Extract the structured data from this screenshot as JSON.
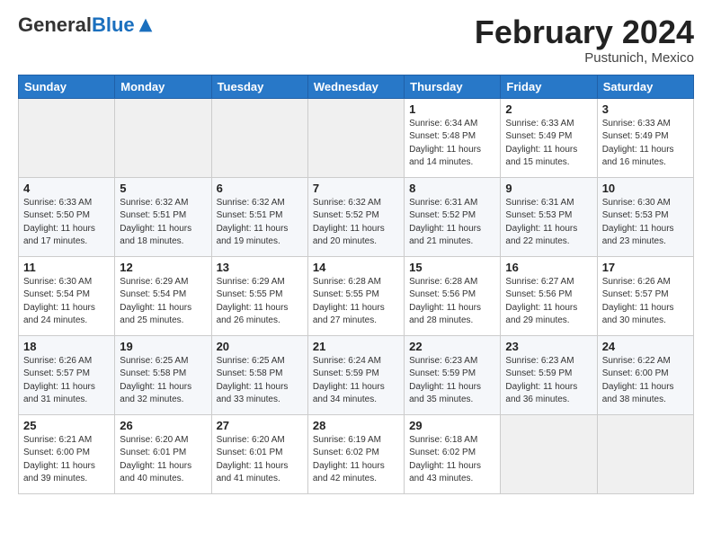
{
  "header": {
    "logo_general": "General",
    "logo_blue": "Blue",
    "month": "February 2024",
    "location": "Pustunich, Mexico"
  },
  "weekdays": [
    "Sunday",
    "Monday",
    "Tuesday",
    "Wednesday",
    "Thursday",
    "Friday",
    "Saturday"
  ],
  "weeks": [
    [
      {
        "day": "",
        "info": ""
      },
      {
        "day": "",
        "info": ""
      },
      {
        "day": "",
        "info": ""
      },
      {
        "day": "",
        "info": ""
      },
      {
        "day": "1",
        "info": "Sunrise: 6:34 AM\nSunset: 5:48 PM\nDaylight: 11 hours\nand 14 minutes."
      },
      {
        "day": "2",
        "info": "Sunrise: 6:33 AM\nSunset: 5:49 PM\nDaylight: 11 hours\nand 15 minutes."
      },
      {
        "day": "3",
        "info": "Sunrise: 6:33 AM\nSunset: 5:49 PM\nDaylight: 11 hours\nand 16 minutes."
      }
    ],
    [
      {
        "day": "4",
        "info": "Sunrise: 6:33 AM\nSunset: 5:50 PM\nDaylight: 11 hours\nand 17 minutes."
      },
      {
        "day": "5",
        "info": "Sunrise: 6:32 AM\nSunset: 5:51 PM\nDaylight: 11 hours\nand 18 minutes."
      },
      {
        "day": "6",
        "info": "Sunrise: 6:32 AM\nSunset: 5:51 PM\nDaylight: 11 hours\nand 19 minutes."
      },
      {
        "day": "7",
        "info": "Sunrise: 6:32 AM\nSunset: 5:52 PM\nDaylight: 11 hours\nand 20 minutes."
      },
      {
        "day": "8",
        "info": "Sunrise: 6:31 AM\nSunset: 5:52 PM\nDaylight: 11 hours\nand 21 minutes."
      },
      {
        "day": "9",
        "info": "Sunrise: 6:31 AM\nSunset: 5:53 PM\nDaylight: 11 hours\nand 22 minutes."
      },
      {
        "day": "10",
        "info": "Sunrise: 6:30 AM\nSunset: 5:53 PM\nDaylight: 11 hours\nand 23 minutes."
      }
    ],
    [
      {
        "day": "11",
        "info": "Sunrise: 6:30 AM\nSunset: 5:54 PM\nDaylight: 11 hours\nand 24 minutes."
      },
      {
        "day": "12",
        "info": "Sunrise: 6:29 AM\nSunset: 5:54 PM\nDaylight: 11 hours\nand 25 minutes."
      },
      {
        "day": "13",
        "info": "Sunrise: 6:29 AM\nSunset: 5:55 PM\nDaylight: 11 hours\nand 26 minutes."
      },
      {
        "day": "14",
        "info": "Sunrise: 6:28 AM\nSunset: 5:55 PM\nDaylight: 11 hours\nand 27 minutes."
      },
      {
        "day": "15",
        "info": "Sunrise: 6:28 AM\nSunset: 5:56 PM\nDaylight: 11 hours\nand 28 minutes."
      },
      {
        "day": "16",
        "info": "Sunrise: 6:27 AM\nSunset: 5:56 PM\nDaylight: 11 hours\nand 29 minutes."
      },
      {
        "day": "17",
        "info": "Sunrise: 6:26 AM\nSunset: 5:57 PM\nDaylight: 11 hours\nand 30 minutes."
      }
    ],
    [
      {
        "day": "18",
        "info": "Sunrise: 6:26 AM\nSunset: 5:57 PM\nDaylight: 11 hours\nand 31 minutes."
      },
      {
        "day": "19",
        "info": "Sunrise: 6:25 AM\nSunset: 5:58 PM\nDaylight: 11 hours\nand 32 minutes."
      },
      {
        "day": "20",
        "info": "Sunrise: 6:25 AM\nSunset: 5:58 PM\nDaylight: 11 hours\nand 33 minutes."
      },
      {
        "day": "21",
        "info": "Sunrise: 6:24 AM\nSunset: 5:59 PM\nDaylight: 11 hours\nand 34 minutes."
      },
      {
        "day": "22",
        "info": "Sunrise: 6:23 AM\nSunset: 5:59 PM\nDaylight: 11 hours\nand 35 minutes."
      },
      {
        "day": "23",
        "info": "Sunrise: 6:23 AM\nSunset: 5:59 PM\nDaylight: 11 hours\nand 36 minutes."
      },
      {
        "day": "24",
        "info": "Sunrise: 6:22 AM\nSunset: 6:00 PM\nDaylight: 11 hours\nand 38 minutes."
      }
    ],
    [
      {
        "day": "25",
        "info": "Sunrise: 6:21 AM\nSunset: 6:00 PM\nDaylight: 11 hours\nand 39 minutes."
      },
      {
        "day": "26",
        "info": "Sunrise: 6:20 AM\nSunset: 6:01 PM\nDaylight: 11 hours\nand 40 minutes."
      },
      {
        "day": "27",
        "info": "Sunrise: 6:20 AM\nSunset: 6:01 PM\nDaylight: 11 hours\nand 41 minutes."
      },
      {
        "day": "28",
        "info": "Sunrise: 6:19 AM\nSunset: 6:02 PM\nDaylight: 11 hours\nand 42 minutes."
      },
      {
        "day": "29",
        "info": "Sunrise: 6:18 AM\nSunset: 6:02 PM\nDaylight: 11 hours\nand 43 minutes."
      },
      {
        "day": "",
        "info": ""
      },
      {
        "day": "",
        "info": ""
      }
    ]
  ]
}
